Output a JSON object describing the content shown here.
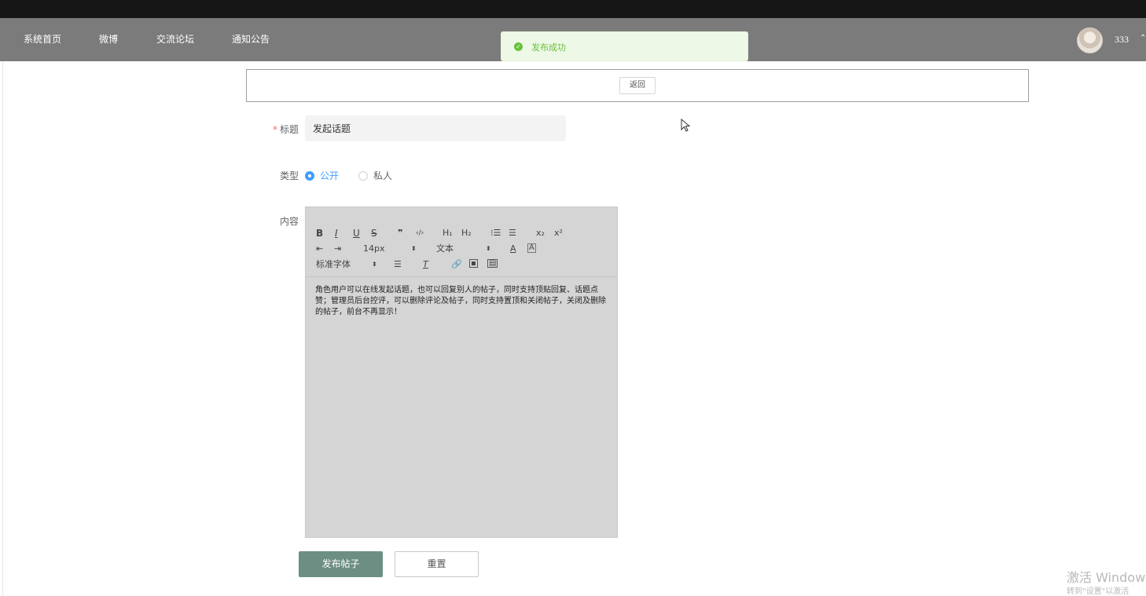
{
  "nav": {
    "items": [
      "系统首页",
      "微博",
      "交流论坛",
      "通知公告"
    ],
    "username": "333"
  },
  "toast": {
    "message": "发布成功",
    "color": "#67c23a"
  },
  "back_button": "返回",
  "form": {
    "title_label": "标题",
    "title_value": "发起话题",
    "type_label": "类型",
    "type_options": [
      "公开",
      "私人"
    ],
    "type_selected": "公开",
    "content_label": "内容",
    "toolbar": {
      "font_size": "14px",
      "block_type": "文本",
      "font_family": "标准字体"
    },
    "content_text": "角色用户可以在线发起话题，也可以回复别人的帖子，同时支持顶贴回复、话题点赞；管理员后台控评，可以删除评论及帖子，同时支持置顶和关闭帖子，关闭及删除的帖子，前台不再显示！"
  },
  "buttons": {
    "submit": "发布帖子",
    "reset": "重置"
  },
  "colors": {
    "navbar": "#7b7b7b",
    "accent": "#409eff",
    "submit": "#6d8f83"
  },
  "watermark": {
    "line1": "激活 Window",
    "line2": "转到\"设置\"以激活"
  }
}
